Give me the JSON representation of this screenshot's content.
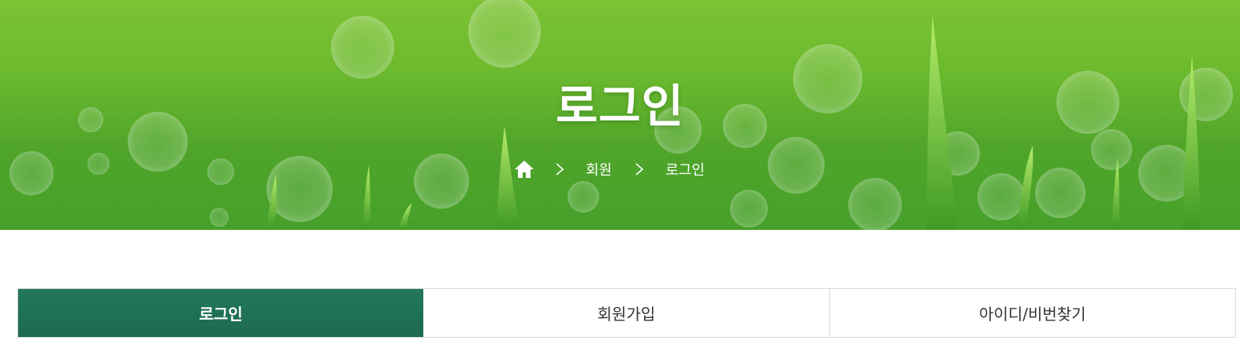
{
  "hero": {
    "title": "로그인",
    "breadcrumb": [
      {
        "label": "회원"
      },
      {
        "label": "로그인"
      }
    ]
  },
  "tabs": [
    {
      "label": "로그인",
      "active": true
    },
    {
      "label": "회원가입",
      "active": false
    },
    {
      "label": "아이디/비번찾기",
      "active": false
    }
  ],
  "colors": {
    "accent": "#1f6f53",
    "hero_green": "#5fb22d",
    "border": "#d9d9d9"
  },
  "icons": {
    "home": "home-icon",
    "separator": "chevron-right-icon"
  }
}
